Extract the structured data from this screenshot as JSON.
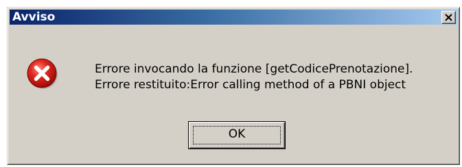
{
  "window": {
    "title": "Avviso",
    "close_icon": "close-x-icon"
  },
  "message": {
    "icon": "error-icon",
    "line1": "Errore invocando la funzione [getCodicePrenotazione].",
    "line2": "Errore restituito:Error calling method of a PBNI object"
  },
  "buttons": {
    "ok_label": "OK"
  },
  "colors": {
    "title_start": "#0a246a",
    "title_end": "#a6caf0",
    "dialog_bg": "#d4d0c8",
    "error_red": "#d42020"
  }
}
